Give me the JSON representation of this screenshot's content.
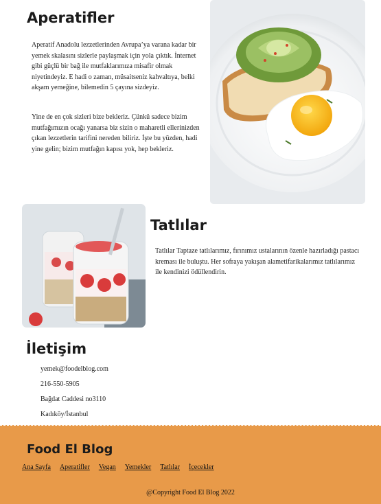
{
  "sections": {
    "aperatifler": {
      "title": "Aperatifler",
      "paragraph1": "Aperatif Anadolu lezzetlerinden Avrupa’ya varana kadar bir yemek skalasını sizlerle paylaşmak için yola çıktık. İnternet gibi güçlü bir bağ ile mutfaklarımıza misafir olmak niyetindeyiz. E hadi o zaman, müsaitseniz kahvaltıya, belki akşam yemeğine, bilemedin 5 çayına sizdeyiz.",
      "paragraph2": "Yine de en çok sizleri bize bekleriz. Çünkü sadece bizim mutfağımızın ocağı yanarsa biz sizin o maharetli ellerinizden çıkan lezzetlerin tarifini nereden biliriz. İşte bu yüzden, hadi yine gelin; bizim mutfağın kapısı yok, hep bekleriz."
    },
    "tatlilar": {
      "title": "Tatlılar",
      "paragraph": "Tatlılar Taptaze tatlılarımız, fırınımız ustalarının özenle hazırladığı pastacı kreması ile buluştu. Her sofraya yakışan alametifarikalarımız tatlılarımız ile kendinizi ödüllendirin."
    },
    "iletisim": {
      "title": "İletişim",
      "email": "yemek@foodelblog.com",
      "phone": "216-550-5905",
      "street": "Bağdat Caddesi no3110",
      "city": "Kadıköy/İstanbul"
    }
  },
  "footer": {
    "brand": "Food El Blog",
    "nav": [
      "Ana Sayfa",
      "Aperatifler",
      "Vegan",
      "Yemekler",
      "Tatlılar",
      "İçecekler"
    ],
    "copyright": "@Copyright Food El Blog 2022"
  },
  "colors": {
    "footer_bg": "#e89a49",
    "heading": "#1b1b1b"
  }
}
